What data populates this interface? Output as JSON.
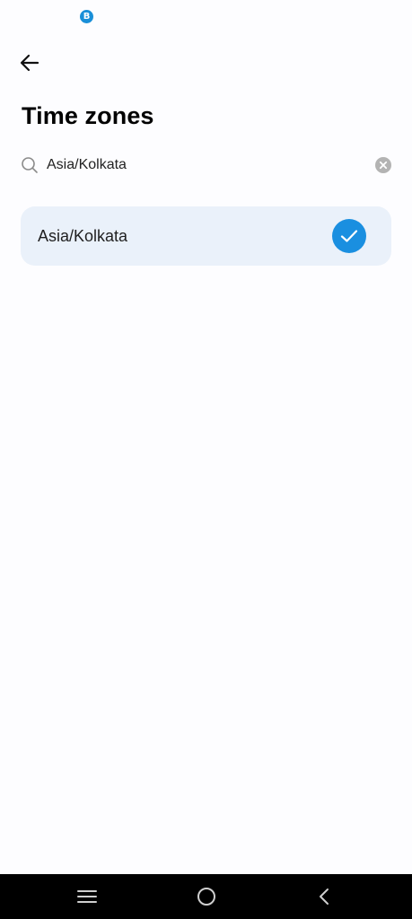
{
  "status_bar": {
    "app_icon_letter": "B"
  },
  "header": {
    "back_icon": "arrow-left-icon",
    "title": "Time zones"
  },
  "search": {
    "icon": "search-icon",
    "value": "Asia/Kolkata",
    "clear_icon": "clear-icon"
  },
  "results": [
    {
      "label": "Asia/Kolkata",
      "selected": true
    }
  ],
  "colors": {
    "accent": "#1a8fe0",
    "selected_row_bg": "#eaf1fa",
    "nav_bar_bg": "#000000"
  },
  "nav_bar": {
    "menu_icon": "menu-icon",
    "home_icon": "home-icon",
    "back_icon": "back-chevron-icon"
  }
}
